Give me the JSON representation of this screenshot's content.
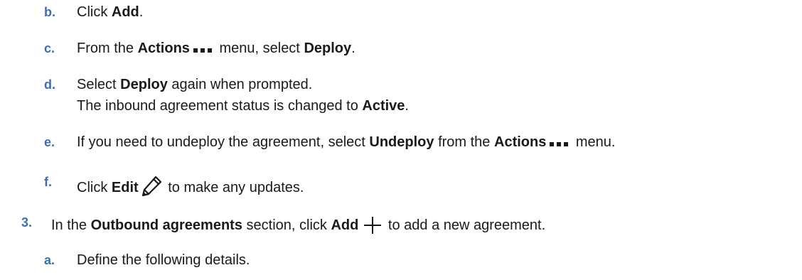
{
  "steps": {
    "b": {
      "marker": "b.",
      "text1": "Click ",
      "bold1": "Add",
      "text2": "."
    },
    "c": {
      "marker": "c.",
      "text1": "From the ",
      "bold1": "Actions",
      "icon": "more-actions-icon",
      "text2": " menu, select ",
      "bold2": "Deploy",
      "text3": "."
    },
    "d": {
      "marker": "d.",
      "text1": "Select ",
      "bold1": "Deploy",
      "text2": " again when prompted.",
      "line2_text": "The inbound agreement status is changed to ",
      "line2_bold": "Active",
      "line2_end": "."
    },
    "e": {
      "marker": "e.",
      "text1": "If you need to undeploy the agreement, select ",
      "bold1": "Undeploy",
      "text2": " from the ",
      "bold2": "Actions",
      "icon": "more-actions-icon",
      "text3": " menu."
    },
    "f": {
      "marker": "f.",
      "text1": "Click ",
      "bold1": "Edit",
      "icon": "pencil-icon",
      "text2": " to make any updates."
    },
    "s3": {
      "marker": "3.",
      "text1": "In the ",
      "bold1": "Outbound agreements",
      "text2": " section, click ",
      "bold2": "Add",
      "icon": "plus-icon",
      "text3": " to add a new agreement."
    },
    "a": {
      "marker": "a.",
      "text1": "Define the following details."
    }
  },
  "colors": {
    "marker": "#3a6fb5",
    "text": "#1a1a1a"
  }
}
